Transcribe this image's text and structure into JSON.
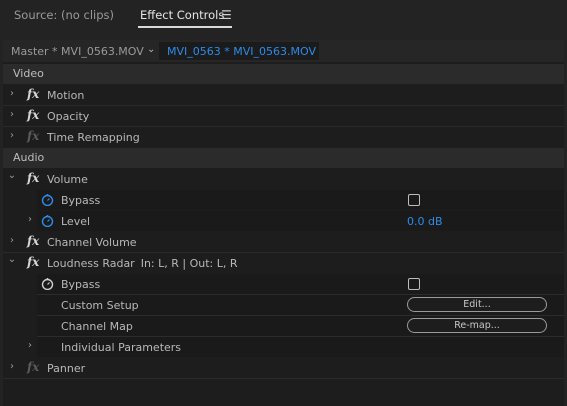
{
  "tabs": {
    "source": "Source: (no clips)",
    "effect_controls": "Effect Controls",
    "menu_icon": "hamburger-menu-icon"
  },
  "clipbar": {
    "master": "Master * MVI_0563.MOV",
    "active": "MVI_0563 * MVI_0563.MOV"
  },
  "sections": {
    "video": "Video",
    "audio": "Audio"
  },
  "effects": {
    "motion": "Motion",
    "opacity": "Opacity",
    "time_remapping": "Time Remapping",
    "volume": "Volume",
    "volume_bypass": "Bypass",
    "volume_level": "Level",
    "volume_level_value": "0.0 dB",
    "channel_volume": "Channel Volume",
    "loudness_radar": "Loudness Radar",
    "loudness_radar_info": "In: L, R | Out: L, R",
    "loudness_bypass": "Bypass",
    "custom_setup": "Custom Setup",
    "custom_setup_button": "Edit...",
    "channel_map": "Channel Map",
    "channel_map_button": "Re-map...",
    "individual_parameters": "Individual Parameters",
    "panner": "Panner"
  },
  "colors": {
    "accent_blue": "#2d8ceb",
    "panel_bg": "#1d1d1d",
    "section_bg": "#2b2b2b"
  },
  "icons": {
    "fx": "fx",
    "chevron_right": "›",
    "chevron_down": "⌄",
    "stopwatch": "stopwatch-icon"
  },
  "checkboxes": {
    "volume_bypass_checked": false,
    "loudness_bypass_checked": false
  }
}
